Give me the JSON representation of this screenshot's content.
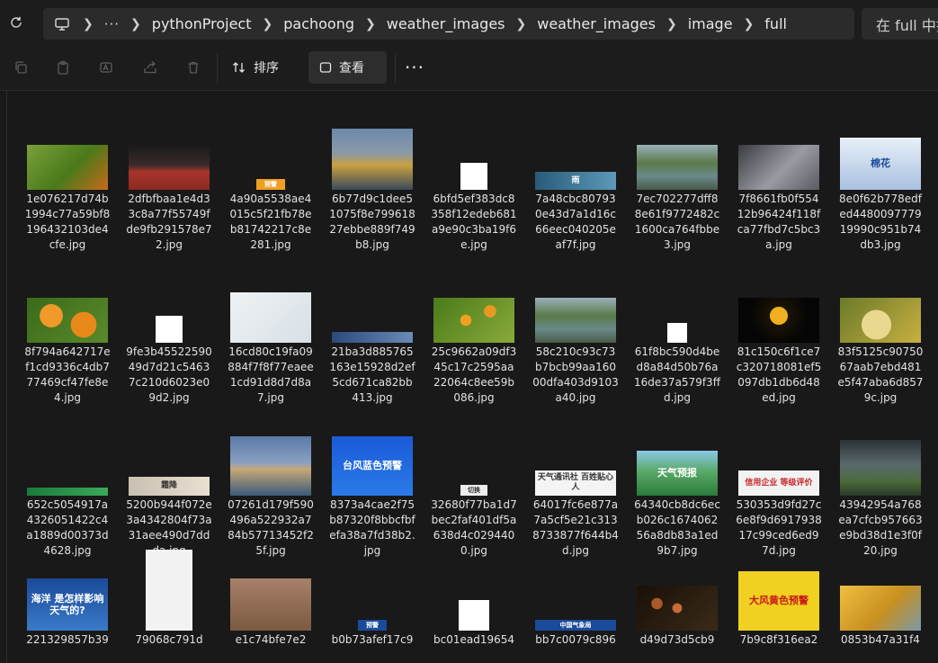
{
  "breadcrumb": {
    "more": "···",
    "items": [
      "pythonProject",
      "pachoong",
      "weather_images",
      "weather_images",
      "image",
      "full"
    ]
  },
  "search": {
    "placeholder": "在 full 中搜索"
  },
  "toolbar": {
    "sort_label": "排序",
    "view_label": "查看",
    "more": "···"
  },
  "files": [
    {
      "name": "1e076217d74b1994c77a59bf8196432103de4cfe.jpg",
      "thumb": "fruit-tree",
      "tc": "#5a8a2a"
    },
    {
      "name": "2dfbfbaa1e4d33c8a77f55749fde9fb291578e72.jpg",
      "thumb": "runner-track",
      "tc": "#8a2a22"
    },
    {
      "name": "4a90a5538ae4015c5f21fb78eb81742217c8e281.jpg",
      "thumb": "warning-badge",
      "tc": "#f0a020",
      "label": "预警"
    },
    {
      "name": "6b77d9c1dee51075f8e79961827ebbe889f749b8.jpg",
      "thumb": "golden-temple",
      "tc": "#6a7f9a"
    },
    {
      "name": "6bfd5ef383dc8358f12edeb681a9e90c3ba19f6e.jpg",
      "thumb": "white-square",
      "tc": "#ffffff"
    },
    {
      "name": "7a48cbc807930e43d7a1d16c66eec040205eaf7f.jpg",
      "thumb": "rain-banner",
      "tc": "#3a6e8a",
      "label": "雨"
    },
    {
      "name": "7ec702277dff88e61f9772482c1600ca764fbbe3.jpg",
      "thumb": "canal",
      "tc": "#6a7a5a"
    },
    {
      "name": "7f8661fb0f55412b96424f118fca77fbd7c5bc3a.jpg",
      "thumb": "cold-person",
      "tc": "#6a6a72"
    },
    {
      "name": "8e0f62b778edfed448009777919990c951b74db3.jpg",
      "thumb": "cotton-poster",
      "tc": "#2a5aa8",
      "label": "棉花"
    },
    {
      "name": "8f794a642717ef1cd9336c4db777469cf47fe8e4.jpg",
      "thumb": "oranges",
      "tc": "#d87a1a"
    },
    {
      "name": "9fe3b4552259049d7d21c54637c210d6023e09d2.jpg",
      "thumb": "white-square",
      "tc": "#ffffff"
    },
    {
      "name": "16cd80c19fa09884f7f8f77eaee1cd91d8d7d8a7.jpg",
      "thumb": "map",
      "tc": "#e8ecef"
    },
    {
      "name": "21ba3d885765163e15928d2ef5cd671ca82bb413.jpg",
      "thumb": "thin-banner",
      "tc": "#3a5a8a"
    },
    {
      "name": "25c9662a09df345c17c2595aa22064c8ee59b086.jpg",
      "thumb": "orange-tree",
      "tc": "#5a8a1a"
    },
    {
      "name": "58c210c93c73b7bcb99aa16000dfa403d9103a40.jpg",
      "thumb": "canal",
      "tc": "#6a7a5a"
    },
    {
      "name": "61f8bc590d4bed8a84d50b76a16de37a579f3ffd.jpg",
      "thumb": "small-white",
      "tc": "#ffffff"
    },
    {
      "name": "81c150c6f1ce7c320718081ef5097db1db6d48ed.jpg",
      "thumb": "moon",
      "tc": "#e0a020"
    },
    {
      "name": "83f5125c9075067aab7ebd481e5f47aba6d8579c.jpg",
      "thumb": "pomelo",
      "tc": "#c8b040"
    },
    {
      "name": "652c5054917a4326051422c4a1889d00373d4628.jpg",
      "thumb": "green-strip",
      "tc": "#2a8a4a"
    },
    {
      "name": "5200b944f072e3a4342804f73a31aee490d7ddda.jpg",
      "thumb": "frost-banner",
      "tc": "#d8d0c0",
      "label": "霜降"
    },
    {
      "name": "07261d179f590496a522932a784b57713452f25f.jpg",
      "thumb": "palace-lake",
      "tc": "#4a6a9a"
    },
    {
      "name": "8373a4cae2f75b87320f8bbcfbfefa38a7fd38b2.jpg",
      "thumb": "typhoon-poster",
      "tc": "#1a6ad8",
      "label": "台风蓝色预警"
    },
    {
      "name": "32680f77ba1d7bec2faf401df5a638d4c0294400.jpg",
      "thumb": "switch-badge",
      "tc": "#2a2a2a",
      "label": "切换"
    },
    {
      "name": "64017fc6e877a7a5cf5e21c3138733877f644b4d.jpg",
      "thumb": "weather-news",
      "tc": "#f4f4f4",
      "label": "天气通讯社 百姓贴心人"
    },
    {
      "name": "64340cb8dc6ecb026c167406256a8db83a1ed9b7.jpg",
      "thumb": "forecast-banner",
      "tc": "#3a8a4a",
      "label": "天气预报"
    },
    {
      "name": "530353d9fd27c6e8f9d691793817c99ced6ed97d.jpg",
      "thumb": "credit-banner",
      "tc": "#f2f2f2",
      "label": "信用企业 等级评价"
    },
    {
      "name": "43942954a768ea7cfcb957663e9bd38d1e3f0f20.jpg",
      "thumb": "storm-clouds",
      "tc": "#3a4a4a"
    },
    {
      "name": "221329857b39",
      "thumb": "ocean-poster",
      "tc": "#1a5aa8",
      "label": "海洋 是怎样影响 天气的?"
    },
    {
      "name": "79068c791d",
      "thumb": "qr-codes",
      "tc": "#f2f2f2"
    },
    {
      "name": "e1c74bfe7e2",
      "thumb": "haze-tower",
      "tc": "#8a6a4a"
    },
    {
      "name": "b0b73afef17c9",
      "thumb": "warning-badge-blue",
      "tc": "#1a4a9a",
      "label": "预警"
    },
    {
      "name": "bc01ead19654",
      "thumb": "loading",
      "tc": "#ffffff"
    },
    {
      "name": "bb7c0079c896",
      "thumb": "blue-strip",
      "tc": "#1a4a9a",
      "label": "中国气象局"
    },
    {
      "name": "d49d73d5cb9",
      "thumb": "dark-flowers",
      "tc": "#3a2a1a"
    },
    {
      "name": "7b9c8f316ea2",
      "thumb": "wind-poster",
      "tc": "#f0d020",
      "label": "大风黄色预警"
    },
    {
      "name": "0853b47a31f4",
      "thumb": "autumn-tree",
      "tc": "#e0b030"
    }
  ]
}
